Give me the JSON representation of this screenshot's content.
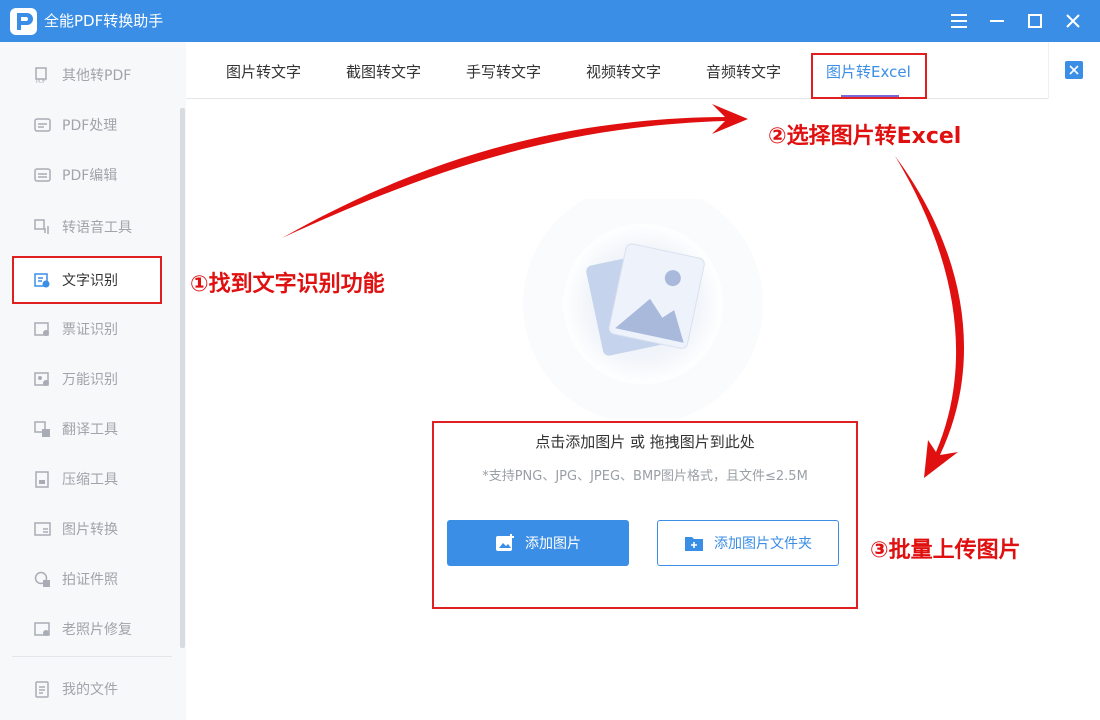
{
  "app": {
    "title": "全能PDF转换助手"
  },
  "sidebar": {
    "items": [
      {
        "label": "其他转PDF",
        "icon": "pdf-file-icon"
      },
      {
        "label": "PDF处理",
        "icon": "pdf-process-icon"
      },
      {
        "label": "PDF编辑",
        "icon": "pdf-edit-icon"
      },
      {
        "label": "转语音工具",
        "icon": "voice-icon"
      },
      {
        "label": "文字识别",
        "icon": "text-recognize-icon",
        "active": true
      },
      {
        "label": "票证识别",
        "icon": "ticket-icon"
      },
      {
        "label": "万能识别",
        "icon": "universal-scan-icon"
      },
      {
        "label": "翻译工具",
        "icon": "translate-icon"
      },
      {
        "label": "压缩工具",
        "icon": "compress-icon"
      },
      {
        "label": "图片转换",
        "icon": "image-convert-icon"
      },
      {
        "label": "拍证件照",
        "icon": "id-photo-icon"
      },
      {
        "label": "老照片修复",
        "icon": "photo-repair-icon"
      }
    ],
    "bottom": {
      "label": "我的文件",
      "icon": "my-files-icon"
    }
  },
  "tabs": [
    {
      "label": "图片转文字"
    },
    {
      "label": "截图转文字"
    },
    {
      "label": "手写转文字"
    },
    {
      "label": "视频转文字"
    },
    {
      "label": "音频转文字"
    },
    {
      "label": "图片转Excel",
      "active": true
    }
  ],
  "upload": {
    "title": "点击添加图片 或 拖拽图片到此处",
    "note": "*支持PNG、JPG、JPEG、BMP图片格式，且文件≤2.5M",
    "add_image": "添加图片",
    "add_folder": "添加图片文件夹"
  },
  "annotations": {
    "step1": "①找到文字识别功能",
    "step2": "②选择图片转Excel",
    "step3": "③批量上传图片"
  },
  "colors": {
    "accent": "#3a8ee6",
    "annotation": "#e02020"
  }
}
